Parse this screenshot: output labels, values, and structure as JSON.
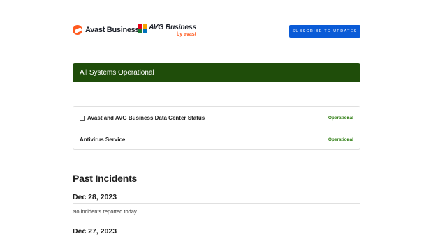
{
  "header": {
    "logo_avast": "Avast Business",
    "logo_avg": "AVG Business",
    "logo_avg_sub": "by avast",
    "subscribe_label": "SUBSCRIBE TO UPDATES"
  },
  "banner": {
    "text": "All Systems Operational",
    "color": "#1f4d0a"
  },
  "components": [
    {
      "name": "Avast and AVG Business Data Center Status",
      "status": "Operational",
      "expandable": true
    },
    {
      "name": "Antivirus Service",
      "status": "Operational",
      "expandable": false
    }
  ],
  "past_incidents": {
    "title": "Past Incidents",
    "days": [
      {
        "date": "Dec 28, 2023",
        "message": "No incidents reported today."
      },
      {
        "date": "Dec 27, 2023",
        "message": ""
      }
    ]
  },
  "colors": {
    "accent": "#0a5bd7",
    "operational": "#2e7d12"
  }
}
